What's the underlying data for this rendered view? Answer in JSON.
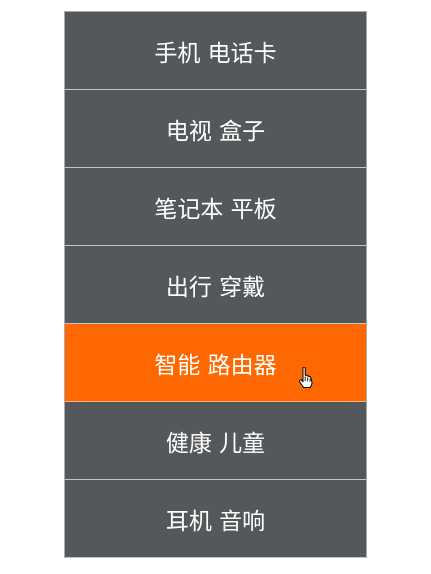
{
  "menu": {
    "items": [
      {
        "label": "手机 电话卡",
        "active": false
      },
      {
        "label": "电视 盒子",
        "active": false
      },
      {
        "label": "笔记本 平板",
        "active": false
      },
      {
        "label": "出行 穿戴",
        "active": false
      },
      {
        "label": "智能 路由器",
        "active": true
      },
      {
        "label": "健康 儿童",
        "active": false
      },
      {
        "label": "耳机 音响",
        "active": false
      }
    ]
  },
  "colors": {
    "item_bg": "#55585a",
    "active_bg": "#ff6700",
    "text": "#ffffff"
  },
  "icons": {
    "cursor": "hand-pointer-icon"
  }
}
